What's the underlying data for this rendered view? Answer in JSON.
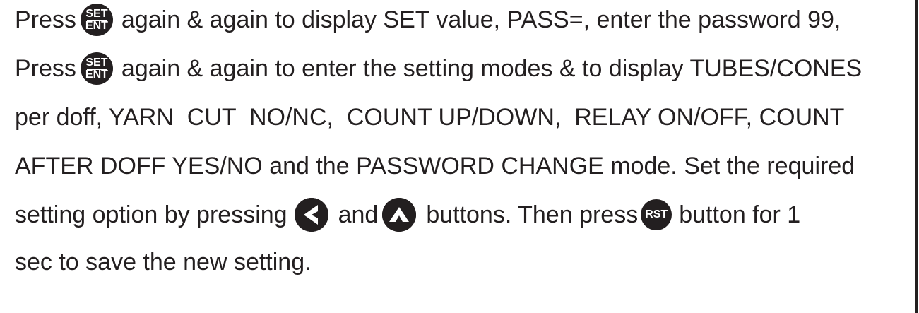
{
  "text": {
    "l1_a": "Press",
    "l1_b": "again & again to display SET value, PASS=, enter the password 99,",
    "l2_a": "Press",
    "l2_b": "again & again to enter the setting modes & to display TUBES/CONES",
    "l3": "per doff, YARN  CUT  NO/NC,  COUNT UP/DOWN,  RELAY ON/OFF, COUNT",
    "l4": "AFTER DOFF YES/NO and the PASSWORD CHANGE mode. Set the required",
    "l5_a": "setting option by pressing",
    "l5_b": "and",
    "l5_c": "buttons. Then press",
    "l5_d": "button for 1",
    "l6": "sec to save the new setting."
  },
  "keys": {
    "set_top": "SET",
    "set_bottom": "ENT",
    "rst": "RST"
  },
  "icons": {
    "set_ent": "set-ent-key-icon",
    "left": "left-arrow-key-icon",
    "up": "up-arrow-key-icon",
    "reset": "rst-key-icon"
  },
  "colors": {
    "ink": "#231f20",
    "background": "#ffffff"
  }
}
